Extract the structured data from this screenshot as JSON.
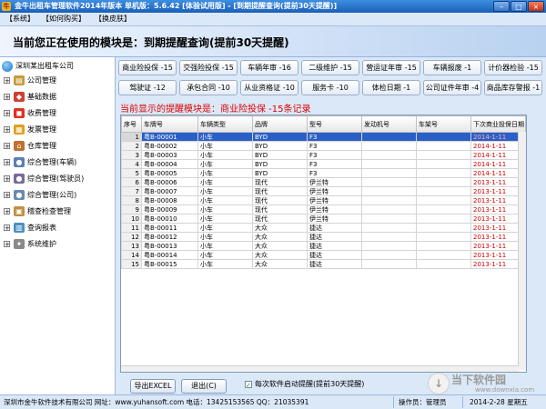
{
  "window": {
    "title": "金牛出租车管理软件2014年版本 单机版：5.6.42 [体验试用版] - [到期提醒查询(提前30天提醒)]",
    "controls": [
      "–",
      "□",
      "×"
    ]
  },
  "menu": [
    {
      "label": "【系统】"
    },
    {
      "label": "【如何购买】"
    },
    {
      "label": "【换皮肤】"
    }
  ],
  "banner": {
    "current_module": "当前您正在使用的模块是：到期提醒查询(提前30天提醒)"
  },
  "sidebar": {
    "root": "深圳某出租车公司",
    "items": [
      {
        "label": "公司管理",
        "icon": "building-icon"
      },
      {
        "label": "基础数据",
        "icon": "database-icon"
      },
      {
        "label": "收费管理",
        "icon": "car-icon"
      },
      {
        "label": "发票管理",
        "icon": "invoice-icon"
      },
      {
        "label": "仓库管理",
        "icon": "warehouse-icon"
      },
      {
        "label": "综合管理(车辆)",
        "icon": "vehicle-icon"
      },
      {
        "label": "综合管理(驾驶员)",
        "icon": "driver-icon"
      },
      {
        "label": "综合管理(公司)",
        "icon": "company-icon"
      },
      {
        "label": "稽查检查管理",
        "icon": "inspection-icon"
      },
      {
        "label": "查询报表",
        "icon": "report-icon"
      },
      {
        "label": "系统维护",
        "icon": "settings-icon"
      }
    ]
  },
  "reminder_buttons": {
    "row1": [
      "商业险投保 -15",
      "交强险投保 -15",
      "车辆年审 -16",
      "二级维护 -15",
      "营运证年审 -15",
      "车辆报废 -1",
      "计价器检验 -15"
    ],
    "row2": [
      "驾驶证 -12",
      "承包合同 -10",
      "从业资格证 -10",
      "服务卡 -10",
      "体检日期 -1",
      "公司证件年审 -4",
      "商品库存警报 -1"
    ]
  },
  "info": "当前显示的提醒模块是：商业险投保  -15条记录",
  "table": {
    "columns": [
      "序号",
      "车牌号",
      "车辆类型",
      "品牌",
      "型号",
      "发动机号",
      "车架号",
      "下次商业投保日期"
    ],
    "rows": [
      [
        "1",
        "粤B-00001",
        "小车",
        "BYD",
        "F3",
        "",
        "",
        "2014-1-11"
      ],
      [
        "2",
        "粤B-00002",
        "小车",
        "BYD",
        "F3",
        "",
        "",
        "2014-1-11"
      ],
      [
        "3",
        "粤B-00003",
        "小车",
        "BYD",
        "F3",
        "",
        "",
        "2014-1-11"
      ],
      [
        "4",
        "粤B-00004",
        "小车",
        "BYD",
        "F3",
        "",
        "",
        "2014-1-11"
      ],
      [
        "5",
        "粤B-00005",
        "小车",
        "BYD",
        "F3",
        "",
        "",
        "2014-1-11"
      ],
      [
        "6",
        "粤B-00006",
        "小车",
        "现代",
        "伊兰特",
        "",
        "",
        "2013-1-11"
      ],
      [
        "7",
        "粤B-00007",
        "小车",
        "现代",
        "伊兰特",
        "",
        "",
        "2013-1-11"
      ],
      [
        "8",
        "粤B-00008",
        "小车",
        "现代",
        "伊兰特",
        "",
        "",
        "2013-1-11"
      ],
      [
        "9",
        "粤B-00009",
        "小车",
        "现代",
        "伊兰特",
        "",
        "",
        "2013-1-11"
      ],
      [
        "10",
        "粤B-00010",
        "小车",
        "现代",
        "伊兰特",
        "",
        "",
        "2013-1-11"
      ],
      [
        "11",
        "粤B-00011",
        "小车",
        "大众",
        "捷达",
        "",
        "",
        "2013-1-11"
      ],
      [
        "12",
        "粤B-00012",
        "小车",
        "大众",
        "捷达",
        "",
        "",
        "2013-1-11"
      ],
      [
        "13",
        "粤B-00013",
        "小车",
        "大众",
        "捷达",
        "",
        "",
        "2013-1-11"
      ],
      [
        "14",
        "粤B-00014",
        "小车",
        "大众",
        "捷达",
        "",
        "",
        "2013-1-11"
      ],
      [
        "15",
        "粤B-00015",
        "小车",
        "大众",
        "捷达",
        "",
        "",
        "2013-1-11"
      ]
    ],
    "selected_row": 1
  },
  "actions": {
    "export_label": "导出EXCEL",
    "exit_label": "退出(C)",
    "startup_reminder_label": "每次软件启动提醒(提前30天提醒)",
    "startup_reminder_checked": true
  },
  "status": {
    "company": "深圳市金牛软件技术有限公司  网址：www.yuhansoft.com  电话：13425153565  QQ：21035391",
    "operator": "操作员：管理员",
    "datetime": "2014-2-28  星期五"
  },
  "watermark": {
    "logo": "↓",
    "text": "当下软件园",
    "url": "www.downxia.com"
  },
  "colors": {
    "accent": "#2b5fc8",
    "alert": "#e00000",
    "panel": "#dbe8f7"
  }
}
